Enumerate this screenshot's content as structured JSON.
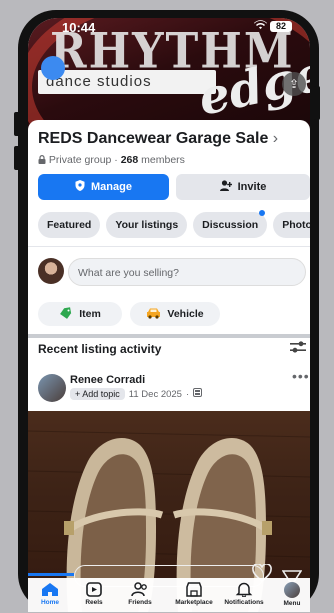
{
  "status": {
    "time": "10:44",
    "battery": "82"
  },
  "cover": {
    "brand_word": "RHYTHM",
    "brand_script": "edge",
    "brand_sub": "dance studios"
  },
  "group": {
    "title": "REDS Dancewear Garage Sale",
    "privacy": "Private group",
    "members_count": "268",
    "members_label": "members"
  },
  "actions": {
    "manage_label": "Manage",
    "invite_label": "Invite"
  },
  "chips": [
    "Featured",
    "Your listings",
    "Discussion",
    "Photos"
  ],
  "composer": {
    "placeholder": "What are you selling?"
  },
  "categories": {
    "item_label": "Item",
    "vehicle_label": "Vehicle"
  },
  "activity": {
    "section_title": "Recent listing activity",
    "poster_name": "Renee Corradi",
    "add_topic": "+ Add topic",
    "date": "11 Dec 2025"
  },
  "tabs": [
    "Home",
    "Reels",
    "Friends",
    "Marketplace",
    "Notifications",
    "Menu"
  ],
  "colors": {
    "accent": "#1877f2",
    "chip_bg": "#e4e6eb"
  }
}
